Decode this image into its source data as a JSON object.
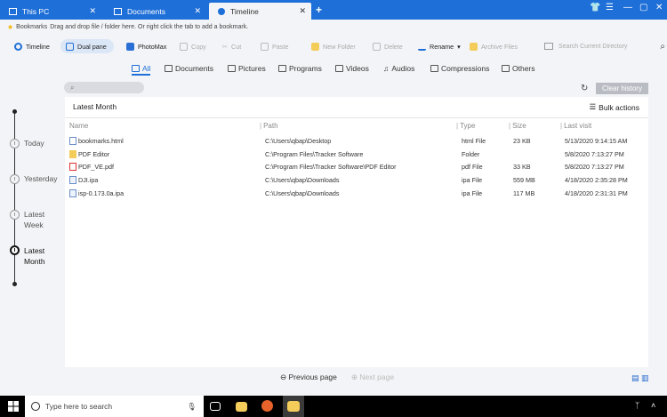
{
  "tabs": [
    {
      "label": "This PC",
      "active": false
    },
    {
      "label": "Documents",
      "active": false
    },
    {
      "label": "Timeline",
      "active": true
    }
  ],
  "bookmarks_bar": {
    "label": "Bookmarks",
    "hint": "Drag and drop file / folder here. Or right click the tab to add a bookmark."
  },
  "toolbar": {
    "timeline": "Timeline",
    "dual_pane": "Dual pane",
    "photomax": "PhotoMax",
    "copy": "Copy",
    "cut": "Cut",
    "paste": "Paste",
    "new_folder": "New Folder",
    "delete": "Delete",
    "rename": "Rename",
    "archive_files": "Archive Files",
    "search_placeholder": "Search Current Directory"
  },
  "filters": [
    "All",
    "Documents",
    "Pictures",
    "Programs",
    "Videos",
    "Audios",
    "Compressions",
    "Others"
  ],
  "active_filter": "All",
  "clear_history": "Clear history",
  "timeline_nodes": [
    {
      "label": "Today",
      "active": false
    },
    {
      "label": "Yesterday",
      "active": false
    },
    {
      "label": "Latest Week",
      "active": false
    },
    {
      "label": "Latest Month",
      "active": true
    }
  ],
  "panel": {
    "title": "Latest Month",
    "bulk_actions": "Bulk actions",
    "columns": [
      "Name",
      "Path",
      "Type",
      "Size",
      "Last visit"
    ],
    "rows": [
      {
        "name": "bookmarks.html",
        "path": "C:\\Users\\qbap\\Desktop",
        "type": "html File",
        "size": "23 KB",
        "last_visit": "5/13/2020 9:14:15 AM",
        "icon": "html-file-icon"
      },
      {
        "name": "PDF Editor",
        "path": "C:\\Program Files\\Tracker Software",
        "type": "Folder",
        "size": "",
        "last_visit": "5/8/2020 7:13:27 PM",
        "icon": "folder-icon"
      },
      {
        "name": "PDF_VE.pdf",
        "path": "C:\\Program Files\\Tracker Software\\PDF Editor",
        "type": "pdf File",
        "size": "33 KB",
        "last_visit": "5/8/2020 7:13:27 PM",
        "icon": "pdf-file-icon"
      },
      {
        "name": "DJI.ipa",
        "path": "C:\\Users\\qbap\\Downloads",
        "type": "ipa File",
        "size": "559 MB",
        "last_visit": "4/18/2020 2:35:28 PM",
        "icon": "ipa-file-icon"
      },
      {
        "name": "isp-0.173.0a.ipa",
        "path": "C:\\Users\\qbap\\Downloads",
        "type": "ipa File",
        "size": "117 MB",
        "last_visit": "4/18/2020 2:31:31 PM",
        "icon": "ipa-file-icon"
      }
    ]
  },
  "pager": {
    "prev": "Previous page",
    "next": "Next page"
  },
  "taskbar": {
    "search_placeholder": "Type here to search"
  },
  "colors": {
    "accent": "#1f6fd8",
    "taskbar": "#000000",
    "clear_btn": "#b9bcc2"
  }
}
